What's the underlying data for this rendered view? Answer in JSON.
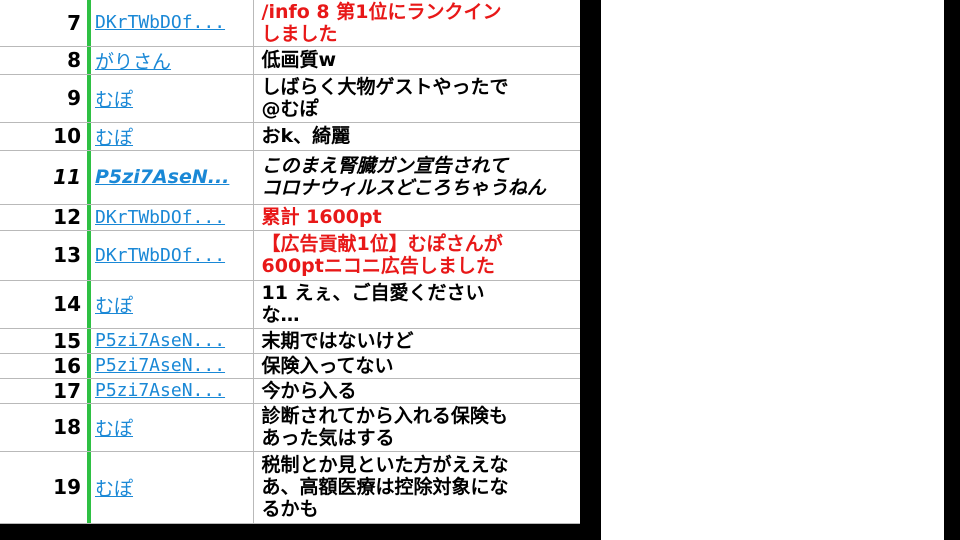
{
  "comments": [
    {
      "no": "7",
      "user": "DKrTWbDOf...",
      "msg": "/info 8 第1位にランクイン\nしました",
      "type": "red",
      "user_style": "mono",
      "h": 46
    },
    {
      "no": "8",
      "user": "がりさん",
      "msg": "低画質w",
      "type": "normal",
      "user_style": "jp",
      "h": 27
    },
    {
      "no": "9",
      "user": "むぽ",
      "msg": "しばらく大物ゲストやったで\n  @むぽ",
      "type": "normal",
      "user_style": "jp",
      "h": 48
    },
    {
      "no": "10",
      "user": "むぽ",
      "msg": "おk、綺麗",
      "type": "normal",
      "user_style": "jp",
      "h": 26
    },
    {
      "no": "11",
      "user": "P5zi7AseN...",
      "msg": "このまえ腎臓ガン宣告されて\nコロナウィルスどころちゃうねん",
      "type": "italic",
      "user_style": "it",
      "h": 54,
      "num_italic": true
    },
    {
      "no": "12",
      "user": "DKrTWbDOf...",
      "msg": "累計 1600pt",
      "type": "red",
      "user_style": "mono",
      "h": 26
    },
    {
      "no": "13",
      "user": "DKrTWbDOf...",
      "msg": "【広告貢献1位】むぽさんが\n600ptニコニ広告しました",
      "type": "red",
      "user_style": "mono",
      "h": 50
    },
    {
      "no": "14",
      "user": "むぽ",
      "msg": "11 えぇ、ご自愛ください\nな…",
      "type": "normal",
      "user_style": "jp",
      "h": 48
    },
    {
      "no": "15",
      "user": "P5zi7AseN...",
      "msg": "末期ではないけど",
      "type": "normal",
      "user_style": "mono",
      "h": 25
    },
    {
      "no": "16",
      "user": "P5zi7AseN...",
      "msg": "保険入ってない",
      "type": "normal",
      "user_style": "mono",
      "h": 25
    },
    {
      "no": "17",
      "user": "P5zi7AseN...",
      "msg": "今から入る",
      "type": "normal",
      "user_style": "mono",
      "h": 25
    },
    {
      "no": "18",
      "user": "むぽ",
      "msg": "診断されてから入れる保険も\nあった気はする",
      "type": "normal",
      "user_style": "jp",
      "h": 48
    },
    {
      "no": "19",
      "user": "むぽ",
      "msg": "税制とか見といた方がええな\nあ、高額医療は控除対象にな\nるかも",
      "type": "normal",
      "user_style": "jp",
      "h": 72
    }
  ]
}
